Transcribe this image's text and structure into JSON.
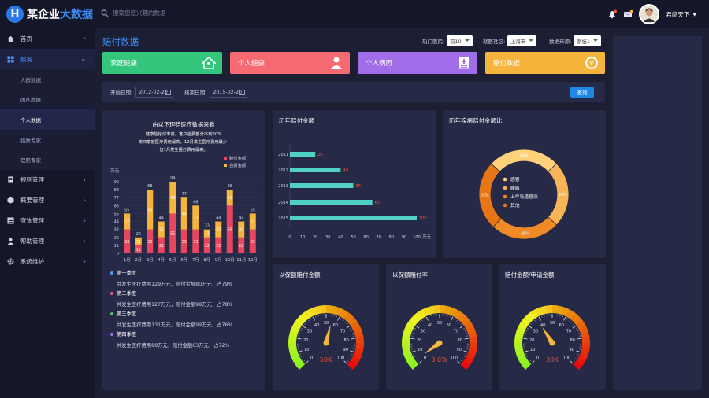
{
  "app": {
    "logo_mark": "H",
    "title_part1": "某企业",
    "title_part2": "大数据"
  },
  "search": {
    "placeholder": "搜索您感兴趣的数据"
  },
  "user": {
    "name": "君临天下",
    "notify_badge": "3"
  },
  "sidebar": {
    "items": [
      {
        "label": "首页",
        "icon": "home-icon"
      },
      {
        "label": "服务",
        "icon": "grid-icon",
        "expanded": true
      },
      {
        "label": "规则管理",
        "icon": "document-icon"
      },
      {
        "label": "概要管理",
        "icon": "cube-icon"
      },
      {
        "label": "查询管理",
        "icon": "list-icon"
      },
      {
        "label": "帮助管理",
        "icon": "person-icon"
      },
      {
        "label": "系统维护",
        "icon": "gear-icon"
      }
    ],
    "sub_items": [
      "人群数据",
      "团队数据",
      "个人数据",
      "指数专家",
      "理赔专家"
    ],
    "current_sub": 2
  },
  "page": {
    "title": "赔付数据"
  },
  "filters": [
    {
      "label": "热门医院:",
      "value": "前10"
    },
    {
      "label": "就医社区:",
      "value": "上海市"
    },
    {
      "label": "数据来源:",
      "value": "系统1"
    }
  ],
  "cards": [
    {
      "label": "家庭健康",
      "color": "#34c77b",
      "icon": "house-icon"
    },
    {
      "label": "个人健康",
      "color": "#f66b71",
      "icon": "user-icon"
    },
    {
      "label": "个人病历",
      "color": "#a16de8",
      "icon": "medical-record-icon"
    },
    {
      "label": "赔付数据",
      "color": "#f5b43b",
      "icon": "coin-icon"
    }
  ],
  "dates": {
    "start_label": "开始日期:",
    "start": "2012-02-20",
    "end_label": "结束日期:",
    "end": "2015-02-20",
    "query": "查询"
  },
  "main_chart": {
    "title": "由以下理赔医疗数据来看",
    "lines": [
      "健康险给付率高，客户自费部分不到20%",
      "第四季度医疗费用最高，12月发生医疗费用最少!",
      "但1月发生医疗费用最高。"
    ],
    "unit": "万元",
    "legend": [
      "赔付金额",
      "自费金额"
    ],
    "y_ticks": [
      "99",
      "88",
      "77",
      "66",
      "55",
      "44",
      "33",
      "22",
      "11",
      "0"
    ]
  },
  "quarters": [
    {
      "title": "第一季度",
      "desc": "共发生医疗费用129万元，赔付金额80万元，占79%",
      "color": "#3ea6ff"
    },
    {
      "title": "第二季度",
      "desc": "共发生医疗费用127万元，赔付金额98万元，占78%",
      "color": "#f05a7a"
    },
    {
      "title": "第三季度",
      "desc": "共发生医疗费用131万元，赔付金额99万元，占76%",
      "color": "#4cc06a"
    },
    {
      "title": "第四季度",
      "desc": "共发生医疗费用88万元，赔付金额63万元，占72%",
      "color": "#a06cf0"
    }
  ],
  "bar_panel": {
    "title": "历年赔付金额",
    "unit": "万元",
    "x_ticks": [
      "0",
      "10",
      "20",
      "30",
      "40",
      "50",
      "60",
      "70",
      "80",
      "90",
      "100"
    ]
  },
  "donut_panel": {
    "title": "历年疾病赔付金额比"
  },
  "gauges": [
    {
      "title": "以保额赔付金额",
      "value_text": "50K",
      "needle_value": 55
    },
    {
      "title": "以保额赔付率",
      "value_text": "3.6%",
      "needle_value": 3.6
    },
    {
      "title": "赔付金额/申请金额",
      "value_text": "38K",
      "needle_value": 38
    }
  ],
  "gauge_ticks": [
    "0",
    "10",
    "20",
    "30",
    "40",
    "50",
    "60",
    "70",
    "80",
    "90",
    "100"
  ],
  "chart_data": [
    {
      "type": "bar",
      "stacked": true,
      "categories": [
        "1月",
        "2月",
        "3月",
        "4月",
        "5月",
        "6月",
        "7月",
        "8月",
        "9月",
        "10月",
        "11月",
        "12月"
      ],
      "series": [
        {
          "name": "赔付金额",
          "values": [
            33,
            11,
            33,
            22,
            55,
            33,
            33,
            22,
            22,
            66,
            22,
            33
          ],
          "color": "#e8465f"
        },
        {
          "name": "自费金额",
          "values": [
            22,
            11,
            55,
            22,
            44,
            44,
            33,
            11,
            22,
            22,
            22,
            22
          ],
          "color": "#f5b43b"
        }
      ],
      "total_labels": [
        "55",
        "22",
        "88",
        "44",
        "99",
        "77",
        "66",
        "33",
        "44",
        "88",
        "44",
        "55"
      ],
      "ylabel": "万元",
      "ylim": [
        0,
        99
      ]
    },
    {
      "type": "bar",
      "orientation": "horizontal",
      "title": "历年赔付金额",
      "categories": [
        "2011",
        "2012",
        "2013",
        "2014",
        "2015"
      ],
      "values": [
        20,
        40,
        50,
        65,
        100
      ],
      "xlabel": "万元",
      "xlim": [
        0,
        100
      ],
      "color": "#4fd1c5"
    },
    {
      "type": "pie",
      "donut": true,
      "title": "历年疾病赔付金额比",
      "labels": [
        "感冒",
        "腰痛",
        "上呼吸道感染",
        "其他"
      ],
      "values": [
        26,
        24,
        25,
        25
      ],
      "slice_labels": [
        "26%",
        "24%",
        "25%",
        "25%"
      ],
      "colors": [
        "#ffd27a",
        "#f7b557",
        "#f08a24",
        "#e87616"
      ]
    }
  ]
}
